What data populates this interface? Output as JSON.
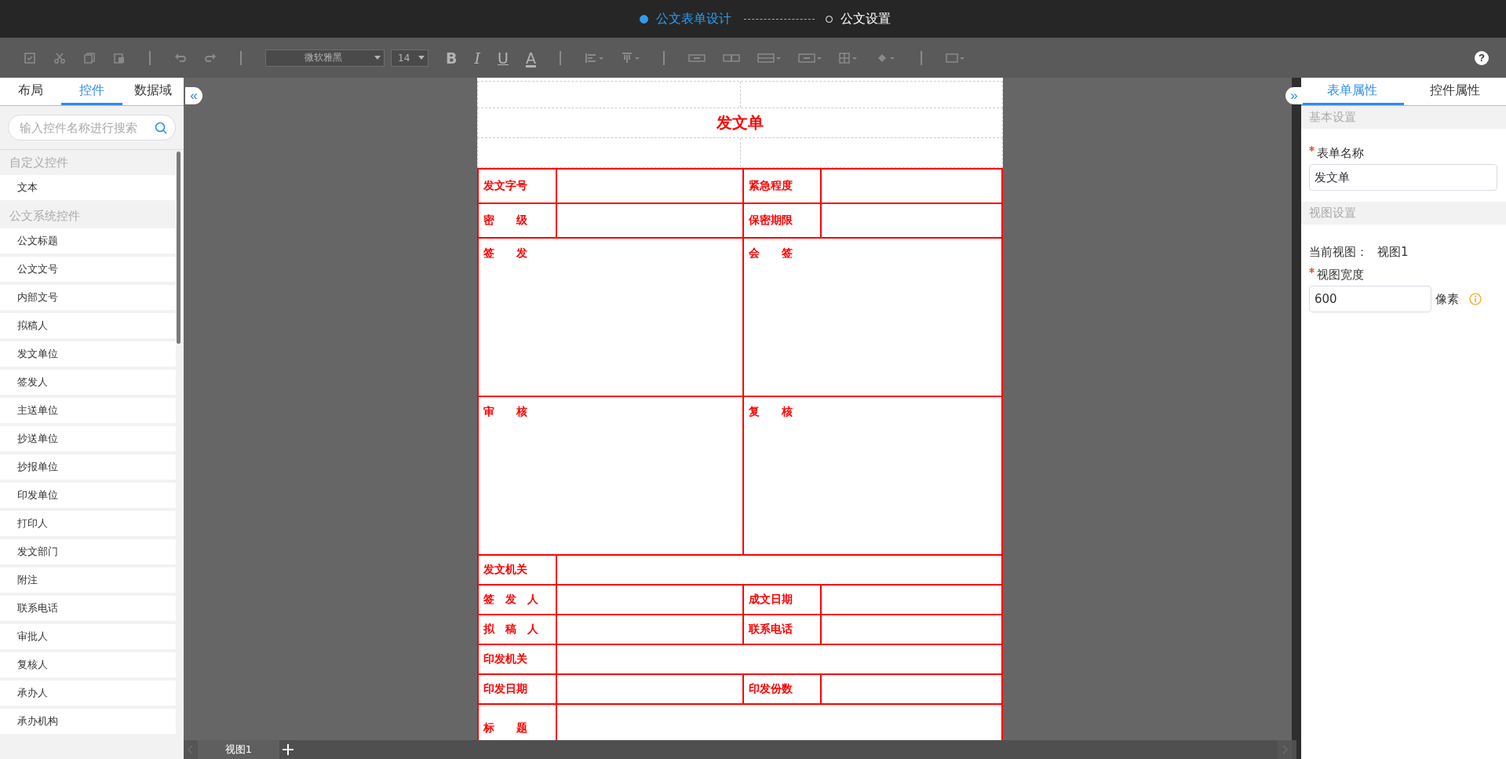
{
  "steps": [
    {
      "label": "公文表单设计",
      "selected": true
    },
    {
      "label": "公文设置",
      "selected": false
    }
  ],
  "toolbar": {
    "disabled": true,
    "font": "微软雅黑",
    "size": "14",
    "format_buttons": [
      "B",
      "I",
      "U",
      "A"
    ],
    "help": "?"
  },
  "left_panel": {
    "collapse": "«",
    "tabs": [
      {
        "label": "布局",
        "selected": false
      },
      {
        "label": "控件",
        "selected": true
      },
      {
        "label": "数据域",
        "selected": false
      }
    ],
    "search": {
      "placeholder": "输入控件名称进行搜索"
    },
    "groups": [
      {
        "title": "自定义控件",
        "items": [
          "文本"
        ]
      },
      {
        "title": "公文系统控件",
        "items": [
          "公文标题",
          "公文文号",
          "内部文号",
          "拟稿人",
          "发文单位",
          "签发人",
          "主送单位",
          "抄送单位",
          "抄报单位",
          "印发单位",
          "打印人",
          "发文部门",
          "附注",
          "联系电话",
          "审批人",
          "复核人",
          "承办人",
          "承办机构"
        ]
      }
    ]
  },
  "form": {
    "title": "发文单",
    "rows": [
      {
        "kind": "pair",
        "cells": [
          "发文字号",
          "紧急程度"
        ]
      },
      {
        "kind": "pair",
        "cells": [
          "密　　级",
          "保密期限"
        ]
      },
      {
        "kind": "tall",
        "cells": [
          "签　　发",
          "会　　签"
        ]
      },
      {
        "kind": "tall",
        "cells": [
          "审　　核",
          "复　　核"
        ]
      },
      {
        "kind": "wide",
        "cells": [
          "发文机关"
        ]
      },
      {
        "kind": "pair",
        "cells": [
          "签　发　人",
          "成文日期"
        ]
      },
      {
        "kind": "pair",
        "cells": [
          "拟　稿　人",
          "联系电话"
        ]
      },
      {
        "kind": "wide",
        "cells": [
          "印发机关"
        ]
      },
      {
        "kind": "pair",
        "cells": [
          "印发日期",
          "印发份数"
        ]
      },
      {
        "kind": "area",
        "cells": [
          "标　　题"
        ]
      }
    ]
  },
  "view_tabs": [
    {
      "label": "视图1"
    }
  ],
  "right_panel": {
    "expand": "»",
    "tabs": [
      {
        "label": "表单属性",
        "selected": true
      },
      {
        "label": "控件属性",
        "selected": false
      }
    ],
    "sections": [
      {
        "title": "基本设置",
        "fields": [
          {
            "kind": "input",
            "label": "表单名称",
            "required": true,
            "value": "发文单"
          }
        ]
      },
      {
        "title": "视图设置",
        "fields": [
          {
            "kind": "text",
            "label": "当前视图：",
            "value": "视图1"
          },
          {
            "kind": "input",
            "label": "视图宽度",
            "required": true,
            "value": "600",
            "unit": "像素",
            "info": true
          }
        ]
      }
    ]
  }
}
